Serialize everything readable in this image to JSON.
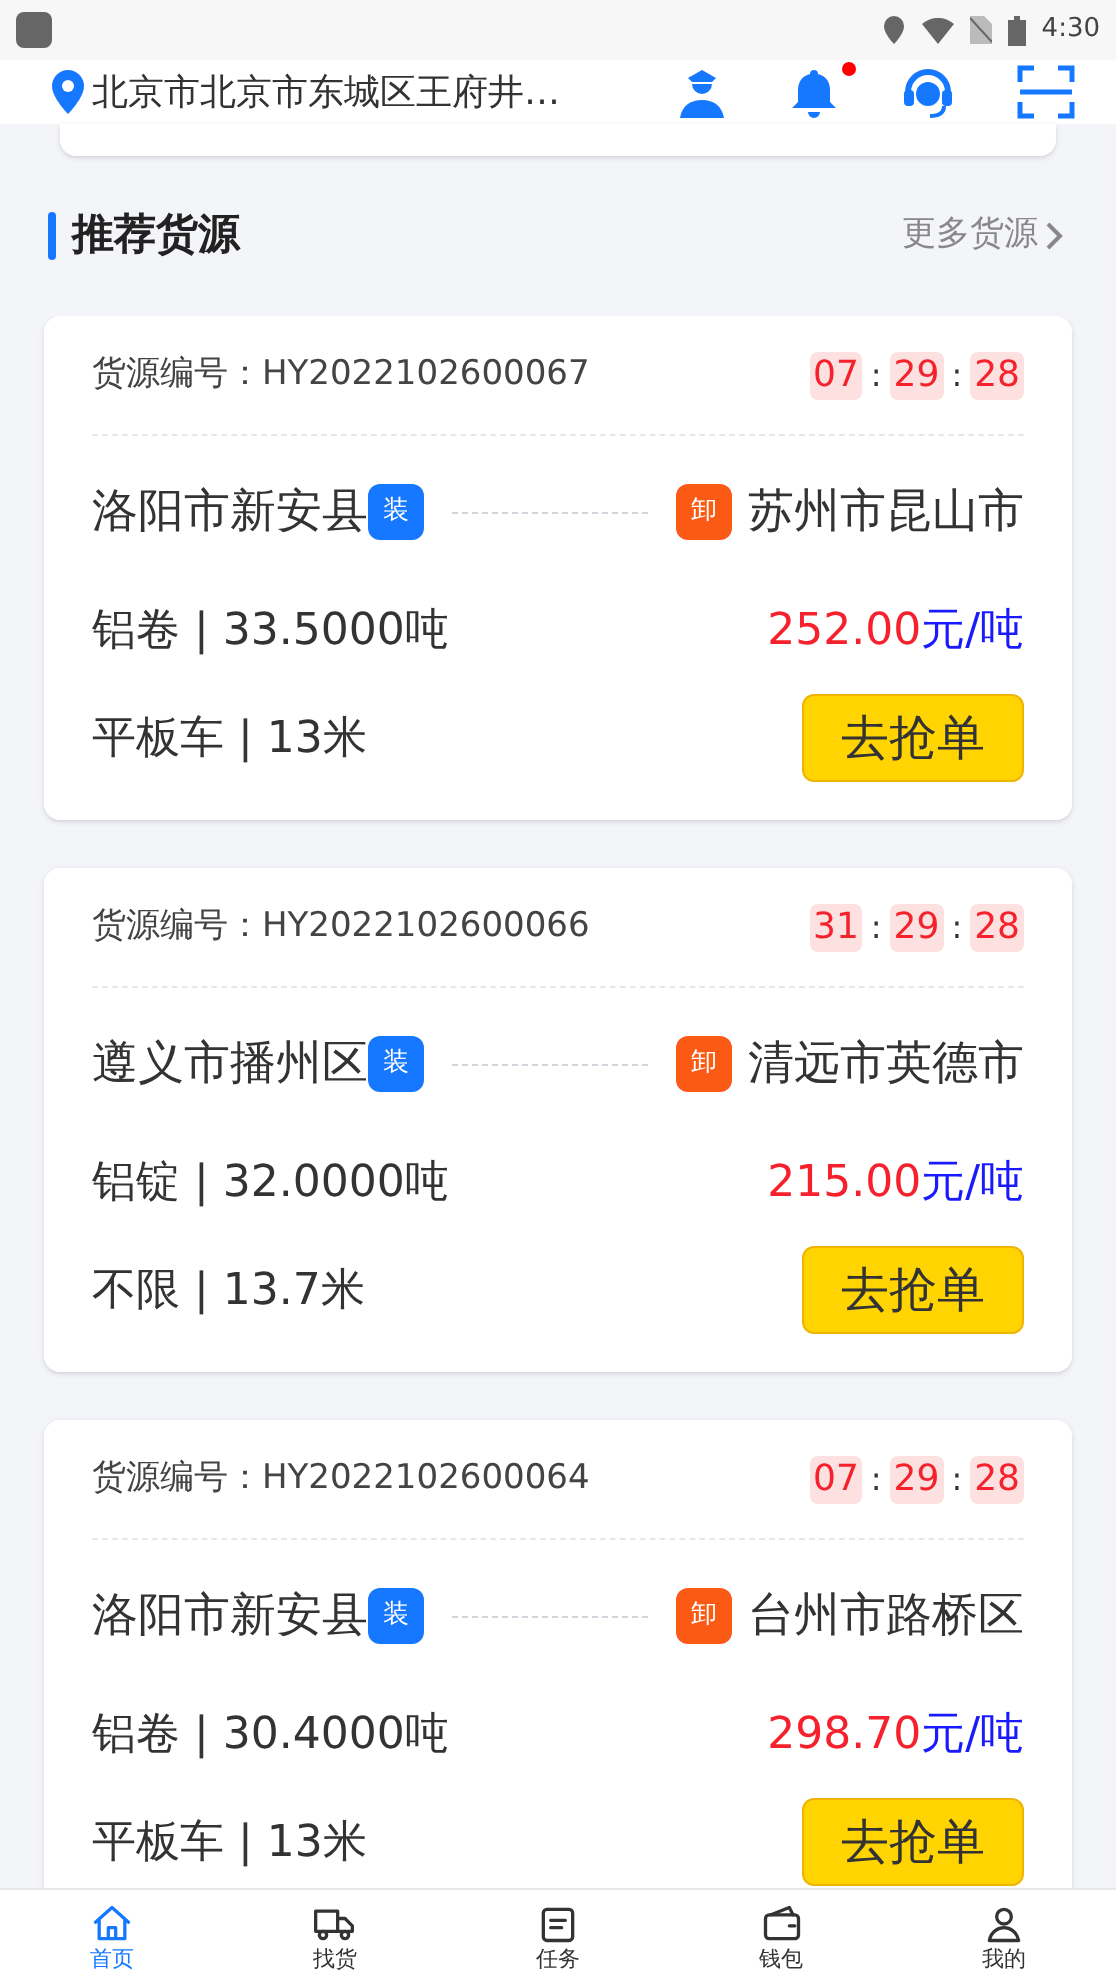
{
  "status_bar": {
    "time": "4:30"
  },
  "header": {
    "location": "北京市北京市东城区王府井…",
    "notification_dot": true
  },
  "section": {
    "title": "推荐货源",
    "more": "更多货源"
  },
  "cargo": [
    {
      "id_label": "货源编号：",
      "id": "HY2022102600067",
      "timer": [
        "07",
        "29",
        "28"
      ],
      "separator": ":",
      "origin": "洛阳市新安县",
      "load_tag": "装",
      "unload_tag": "卸",
      "destination": "苏州市昆山市",
      "goods": "铝卷 | 33.5000吨",
      "price": "252.00",
      "unit": "元/吨",
      "vehicle": "平板车 | 13米",
      "action": "去抢单"
    },
    {
      "id_label": "货源编号：",
      "id": "HY2022102600066",
      "timer": [
        "31",
        "29",
        "28"
      ],
      "separator": ":",
      "origin": "遵义市播州区",
      "load_tag": "装",
      "unload_tag": "卸",
      "destination": "清远市英德市",
      "goods": "铝锭 | 32.0000吨",
      "price": "215.00",
      "unit": "元/吨",
      "vehicle": "不限 | 13.7米",
      "action": "去抢单"
    },
    {
      "id_label": "货源编号：",
      "id": "HY2022102600064",
      "timer": [
        "07",
        "29",
        "28"
      ],
      "separator": ":",
      "origin": "洛阳市新安县",
      "load_tag": "装",
      "unload_tag": "卸",
      "destination": "台州市路桥区",
      "goods": "铝卷 | 30.4000吨",
      "price": "298.70",
      "unit": "元/吨",
      "vehicle": "平板车 | 13米",
      "action": "去抢单"
    }
  ],
  "tabs": [
    {
      "label": "首页",
      "kind": "home",
      "selected": true
    },
    {
      "label": "找货",
      "kind": "truck",
      "selected": false
    },
    {
      "label": "任务",
      "kind": "task",
      "selected": false
    },
    {
      "label": "钱包",
      "kind": "wallet",
      "selected": false
    },
    {
      "label": "我的",
      "kind": "user",
      "selected": false
    }
  ]
}
